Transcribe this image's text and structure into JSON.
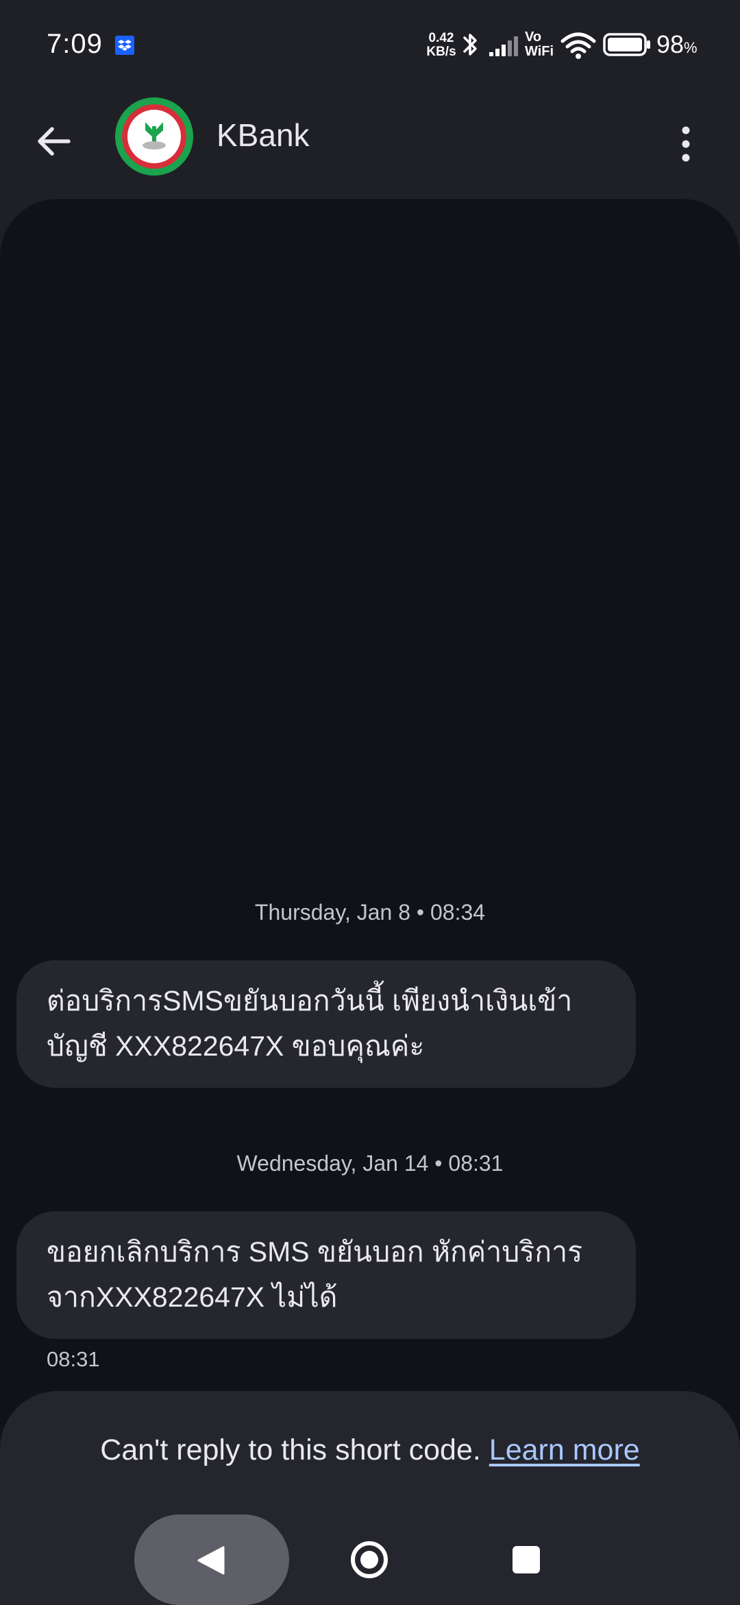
{
  "status_bar": {
    "time": "7:09",
    "net_speed_value": "0.42",
    "net_speed_unit": "KB/s",
    "vowifi_top": "Vo",
    "vowifi_bottom": "WiFi",
    "battery_percent": "98",
    "battery_suffix": "%",
    "icons": [
      "dropbox-icon",
      "bluetooth-icon",
      "signal-icon",
      "wifi-icon",
      "battery-icon"
    ]
  },
  "app_bar": {
    "contact_name": "KBank",
    "back_icon": "arrow-back-icon",
    "menu_icon": "more-vertical-icon"
  },
  "conversation": {
    "messages": [
      {
        "date_divider": "Thursday, Jan 8 • 08:34",
        "text": "ต่อบริการSMSขยันบอกวันนี้ เพียงนำเงินเข้าบัญชี XXX822647X ขอบคุณค่ะ"
      },
      {
        "date_divider": "Wednesday, Jan 14 • 08:31",
        "text": "ขอยกเลิกบริการ SMS ขยันบอก หักค่าบริการจากXXX822647X ไม่ได้",
        "time": "08:31"
      }
    ]
  },
  "footer": {
    "notice": "Can't reply to this short code.",
    "link": "Learn more"
  },
  "nav_bar": {
    "icons": [
      "nav-back-icon",
      "nav-home-icon",
      "nav-recents-icon"
    ]
  },
  "colors": {
    "background": "#1f2026",
    "conversation_bg": "#111217",
    "bubble": "#25262e",
    "link": "#aac7ff",
    "kbank_green": "#1ba34d",
    "kbank_red": "#d62f3a"
  }
}
